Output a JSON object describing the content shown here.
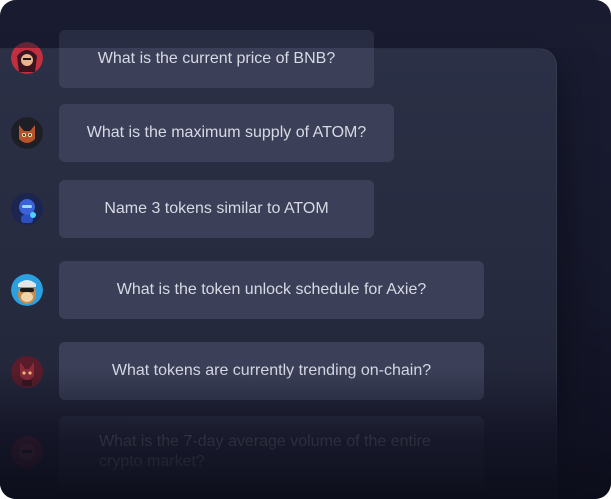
{
  "messages": [
    {
      "text": "What is the current price of BNB?",
      "avatar": "red-hooded-character-avatar",
      "color": "#c23040"
    },
    {
      "text": "What is the maximum supply of ATOM?",
      "avatar": "fox-character-avatar",
      "color": "#b5542a"
    },
    {
      "text": "Name 3 tokens similar to ATOM",
      "avatar": "blue-robot-avatar",
      "color": "#3b63d9"
    },
    {
      "text": "What is the token unlock schedule for Axie?",
      "avatar": "ape-character-avatar",
      "color": "#2aa0e0"
    },
    {
      "text": "What tokens are currently trending on-chain?",
      "avatar": "fox-warrior-avatar",
      "color": "#8c2a3a"
    },
    {
      "text": "What is the 7-day average volume of the entire crypto market?",
      "avatar": "red-character-avatar",
      "color": "#a02a3a"
    }
  ]
}
